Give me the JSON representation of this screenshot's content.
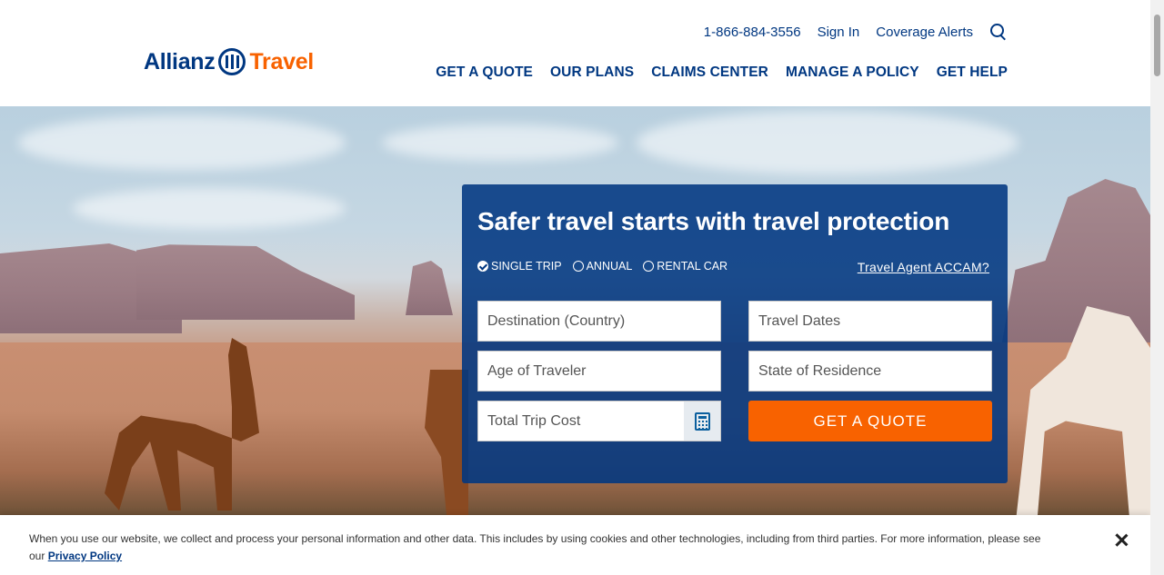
{
  "brand": {
    "name_part1": "Allianz",
    "name_part2": "Travel",
    "primary_color": "#003781",
    "accent_color": "#f86200"
  },
  "utility_nav": {
    "phone": "1-866-884-3556",
    "sign_in": "Sign In",
    "coverage_alerts": "Coverage Alerts",
    "search_icon": "search-icon"
  },
  "main_nav": [
    "GET A QUOTE",
    "OUR PLANS",
    "CLAIMS CENTER",
    "MANAGE A POLICY",
    "GET HELP"
  ],
  "quote_form": {
    "title": "Safer travel starts with travel protection",
    "trip_types": [
      {
        "label": "SINGLE TRIP",
        "checked": true
      },
      {
        "label": "ANNUAL",
        "checked": false
      },
      {
        "label": "RENTAL CAR",
        "checked": false
      }
    ],
    "travel_agent_link": "Travel Agent ACCAM?",
    "fields": {
      "destination": "Destination (Country)",
      "travel_dates": "Travel Dates",
      "age": "Age of Traveler",
      "state": "State of Residence",
      "trip_cost": "Total Trip Cost"
    },
    "calculator_icon": "calculator-icon",
    "submit_label": "GET A QUOTE"
  },
  "cookie_banner": {
    "text": "When you use our website, we collect and process your personal information and other data. This includes by using cookies and other technologies, including from third parties. For more information, please see our",
    "link_label": "Privacy Policy",
    "close_icon": "close-icon"
  }
}
